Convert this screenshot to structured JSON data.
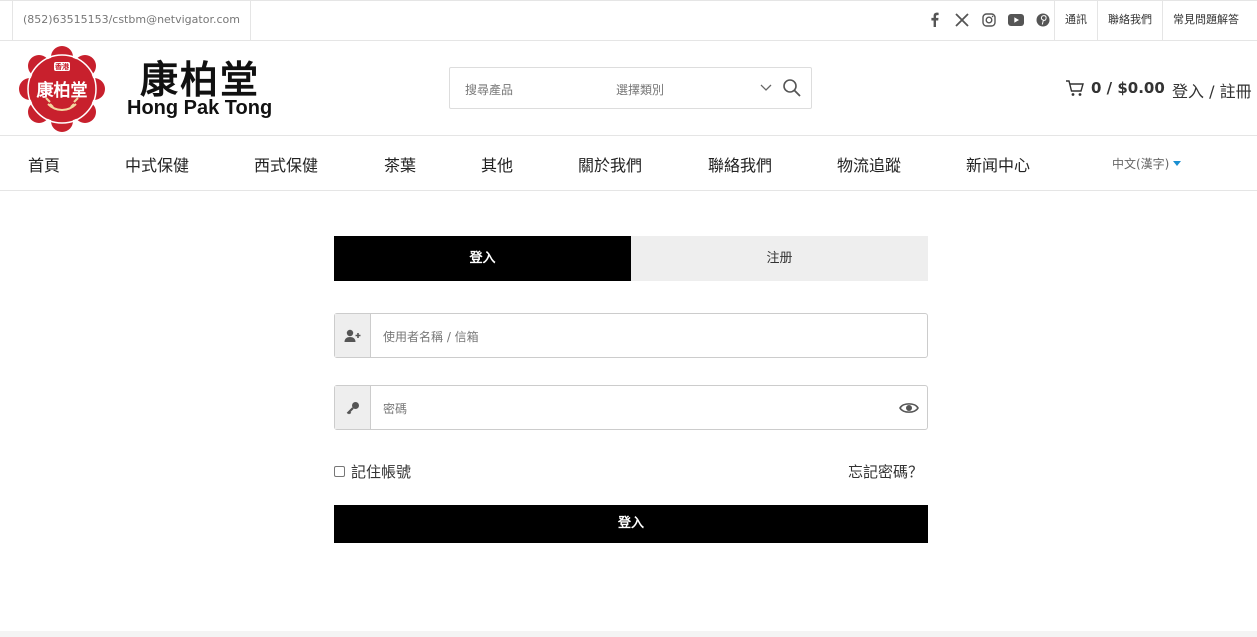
{
  "topbar": {
    "contact": "(852)63515153/cstbm@netvigator.com",
    "socials": [
      "facebook-icon",
      "x-icon",
      "instagram-icon",
      "youtube-icon",
      "pinterest-icon"
    ],
    "links": [
      "通訊",
      "聯絡我們",
      "常見問題解答"
    ]
  },
  "header": {
    "logo_text": "康柏堂",
    "logo_small": "香港",
    "brand_cn": "康柏堂",
    "brand_en": "Hong Pak Tong",
    "search_placeholder": "搜尋產品",
    "category_placeholder": "選擇類別",
    "cart_total": "0 / $0.00",
    "login_register": "登入 / 註冊"
  },
  "nav": {
    "items": [
      "首頁",
      "中式保健",
      "西式保健",
      "茶葉",
      "其他",
      "關於我們",
      "聯絡我們",
      "物流追蹤",
      "新闻中心"
    ],
    "language": "中文(漢字)"
  },
  "login": {
    "tab_login": "登入",
    "tab_register": "注册",
    "username_placeholder": "使用者名稱 / 信箱",
    "password_placeholder": "密碼",
    "remember_label": "記住帳號",
    "forgot_label": "忘記密碼？",
    "submit_label": "登入"
  },
  "colors": {
    "brand_red": "#c8202d",
    "accent_blue": "#1a8fd1",
    "primary_black": "#000000"
  }
}
